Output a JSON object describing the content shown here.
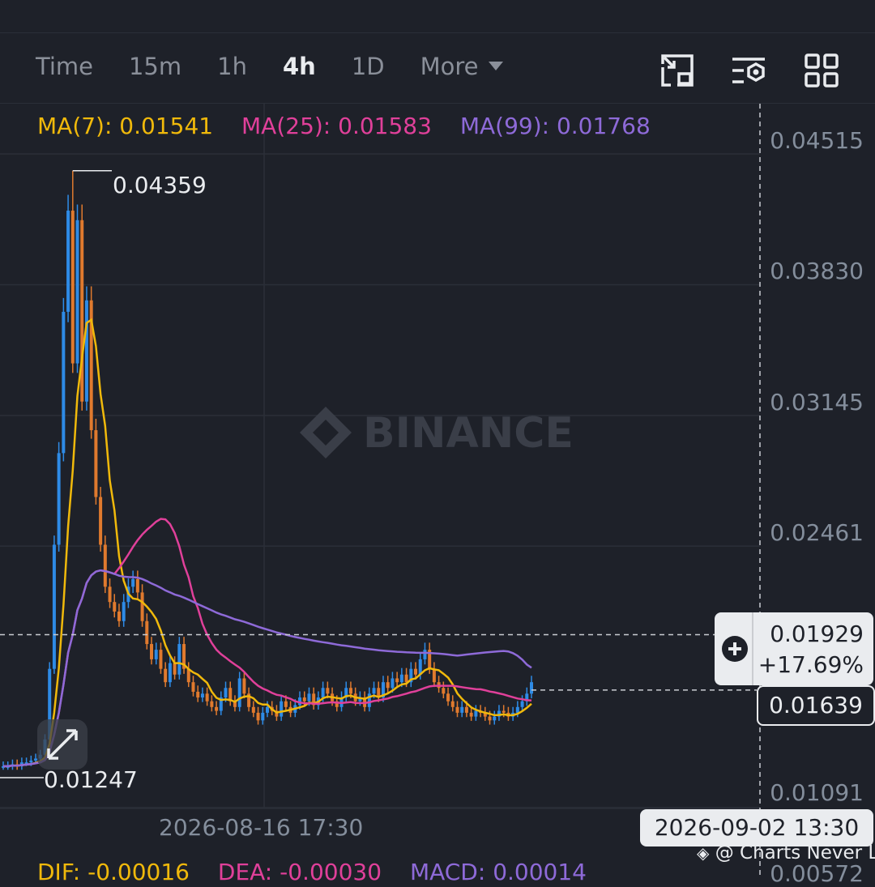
{
  "toolbar": {
    "tabs": [
      "Time",
      "15m",
      "1h",
      "4h",
      "1D",
      "More"
    ],
    "active_tab": "4h",
    "icons": [
      "fullscreen-exit-icon",
      "indicator-settings-icon",
      "grid-layout-icon"
    ]
  },
  "ma_legend": {
    "ma7": "MA(7): 0.01541",
    "ma25": "MA(25): 0.01583",
    "ma99": "MA(99): 0.01768"
  },
  "brand_watermark": "BINANCE",
  "price_axis": [
    "0.04515",
    "0.03830",
    "0.03145",
    "0.02461",
    "0.01091",
    "0.00572"
  ],
  "high_label": "0.04359",
  "low_label": "0.01247",
  "crosshair": {
    "price": "0.01929",
    "change": "+17.69%",
    "time": "2026-09-02 13:30"
  },
  "current_price": "0.01639",
  "time_axis_label": "2026-08-16 17:30",
  "credit": "@ Charts Never Lie",
  "macd_legend": {
    "dif": "DIF: -0.00016",
    "dea": "DEA: -0.00030",
    "macd": "MACD: 0.00014"
  },
  "colors": {
    "background": "#1e2129",
    "up": "#2e8be6",
    "down": "#e07a2e",
    "ma7": "#f0b90b",
    "ma25": "#e0409a",
    "ma99": "#8e6ad8",
    "text": "#eaecef"
  },
  "chart_data": {
    "type": "candlestick",
    "interval": "4h",
    "ylim": [
      0.01091,
      0.04515
    ],
    "y_ticks": [
      0.04515,
      0.0383,
      0.03145,
      0.02461,
      0.01091
    ],
    "high": 0.04359,
    "low": 0.01247,
    "last": 0.01639,
    "crosshair_price": 0.01929,
    "candles_close": [
      0.0124,
      0.0124,
      0.0125,
      0.0124,
      0.0126,
      0.0126,
      0.0127,
      0.0128,
      0.013,
      0.0138,
      0.0175,
      0.024,
      0.0288,
      0.0362,
      0.0415,
      0.0335,
      0.041,
      0.0315,
      0.0368,
      0.03,
      0.0265,
      0.024,
      0.0218,
      0.021,
      0.0205,
      0.02,
      0.021,
      0.0218,
      0.0222,
      0.0215,
      0.02,
      0.0188,
      0.018,
      0.0185,
      0.0175,
      0.0168,
      0.0178,
      0.0172,
      0.0188,
      0.0175,
      0.0168,
      0.0163,
      0.016,
      0.0162,
      0.0158,
      0.0155,
      0.0153,
      0.016,
      0.0165,
      0.0158,
      0.0155,
      0.017,
      0.0162,
      0.0155,
      0.0152,
      0.0148,
      0.0152,
      0.0155,
      0.0153,
      0.015,
      0.0158,
      0.0155,
      0.0152,
      0.0156,
      0.016,
      0.0158,
      0.0162,
      0.0156,
      0.016,
      0.0165,
      0.0162,
      0.0158,
      0.0155,
      0.016,
      0.0165,
      0.0162,
      0.0158,
      0.016,
      0.0155,
      0.0162,
      0.0165,
      0.016,
      0.0168,
      0.0165,
      0.017,
      0.0168,
      0.0172,
      0.0168,
      0.0175,
      0.0172,
      0.018,
      0.0185,
      0.0175,
      0.0168,
      0.0165,
      0.0162,
      0.0158,
      0.0155,
      0.0152,
      0.0155,
      0.0152,
      0.015,
      0.0153,
      0.0152,
      0.015,
      0.0148,
      0.015,
      0.0153,
      0.0152,
      0.015,
      0.0152,
      0.0155,
      0.0158,
      0.0162,
      0.0168
    ],
    "ma_series": [
      {
        "name": "MA(7)",
        "last": 0.01541
      },
      {
        "name": "MA(25)",
        "last": 0.01583
      },
      {
        "name": "MA(99)",
        "last": 0.01768
      }
    ]
  }
}
